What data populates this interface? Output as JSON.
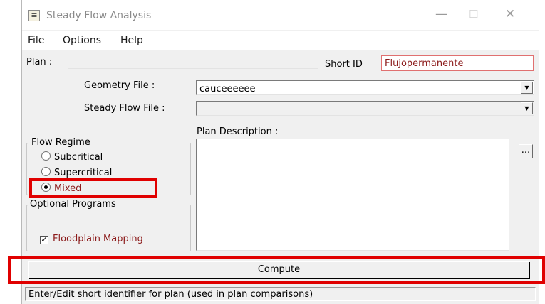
{
  "window": {
    "title": "Steady Flow Analysis",
    "minimize_glyph": "—",
    "maximize_glyph": "☐",
    "close_glyph": "✕",
    "app_icon_glyph": "≡"
  },
  "menu": [
    "File",
    "Options",
    "Help"
  ],
  "plan": {
    "label": "Plan :",
    "value": ""
  },
  "short_id": {
    "label": "Short ID",
    "value": "Flujopermanente"
  },
  "geometry_file": {
    "label": "Geometry File :",
    "value": "cauceeeeee"
  },
  "steady_flow_file": {
    "label": "Steady Flow File :",
    "value": ""
  },
  "flow_regime": {
    "title": "Flow Regime",
    "options": [
      "Subcritical",
      "Supercritical",
      "Mixed"
    ],
    "selected": "Mixed"
  },
  "optional_programs": {
    "title": "Optional Programs",
    "floodplain_mapping": {
      "label": "Floodplain Mapping",
      "checked": true,
      "check_glyph": "✓"
    }
  },
  "plan_description": {
    "label": "Plan Description :",
    "value": "",
    "ellipsis_button": "..."
  },
  "compute_button": "Compute",
  "status_bar": "Enter/Edit short identifier for plan (used in plan comparisons)",
  "dropdown_glyph": "▼",
  "colors": {
    "highlight": "#e00000",
    "accent_text": "#8b1a1a"
  }
}
